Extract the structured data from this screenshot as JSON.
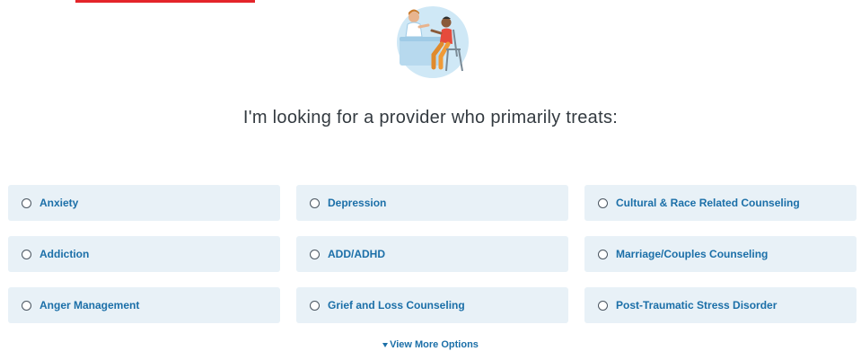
{
  "header": {
    "accent_color": "#e4252a"
  },
  "illustration": {
    "icon": "provider-consultation-illustration"
  },
  "heading": {
    "text": "I'm looking for a provider who primarily treats:"
  },
  "options": [
    {
      "label": "Anxiety"
    },
    {
      "label": "Depression"
    },
    {
      "label": "Cultural & Race Related Counseling"
    },
    {
      "label": "Addiction"
    },
    {
      "label": "ADD/ADHD"
    },
    {
      "label": "Marriage/Couples Counseling"
    },
    {
      "label": "Anger Management"
    },
    {
      "label": "Grief and Loss Counseling"
    },
    {
      "label": "Post-Traumatic Stress Disorder"
    }
  ],
  "view_more": {
    "label": "View More Options",
    "icon": "caret-down-icon"
  },
  "colors": {
    "option_background": "#e8f1f7",
    "link_blue": "#1b6fa8"
  }
}
